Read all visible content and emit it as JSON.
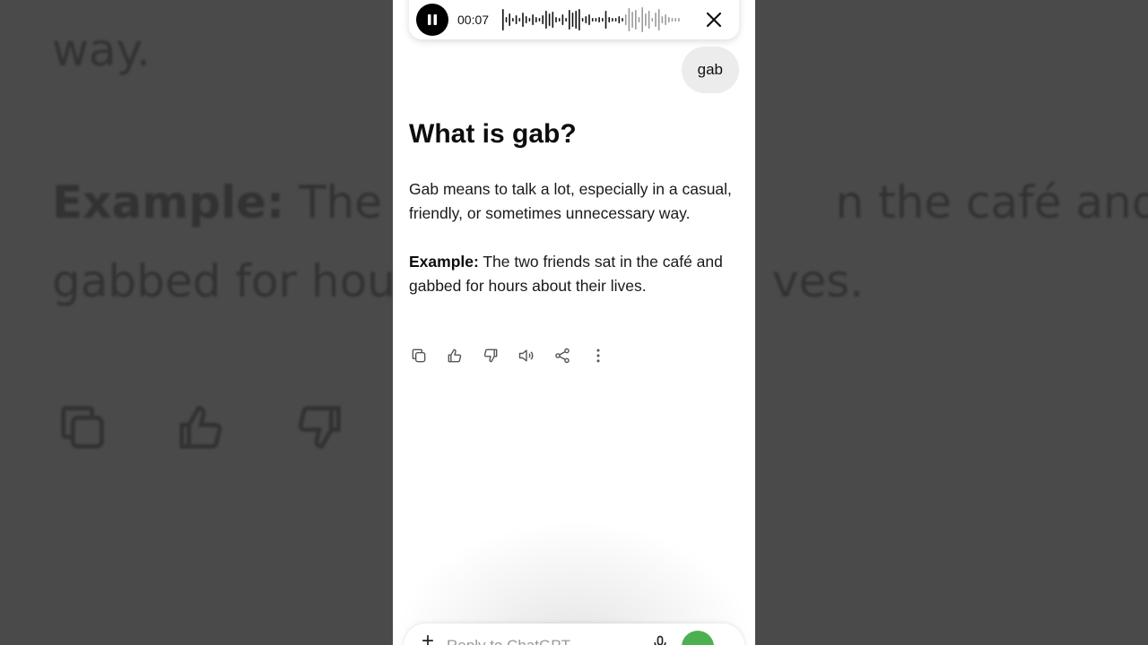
{
  "background": {
    "line1": "way.",
    "line2_bold": "Example:",
    "line2_a": " The t",
    "line2_b": "n the café and",
    "line3_a": "gabbed for hou",
    "line3_b": "ves."
  },
  "voice": {
    "timer": "00:07"
  },
  "chat": {
    "user_message": "gab",
    "title": "What is gab?",
    "definition": "Gab means to talk a lot, especially in a casual, friendly, or sometimes unnecessary way.",
    "example_label": "Example:",
    "example_text": " The two friends sat in the café and gabbed for hours about their lives."
  },
  "composer": {
    "placeholder": "Reply to ChatGPT"
  },
  "colors": {
    "accent": "#4caf50",
    "bubble": "#ececec"
  },
  "icons": {
    "pause": "pause-icon",
    "close": "close-icon",
    "copy": "copy-icon",
    "like": "thumbs-up-icon",
    "dislike": "thumbs-down-icon",
    "speak": "speaker-icon",
    "share": "share-icon",
    "more": "more-icon",
    "plus": "plus-icon",
    "mic": "mic-icon"
  }
}
